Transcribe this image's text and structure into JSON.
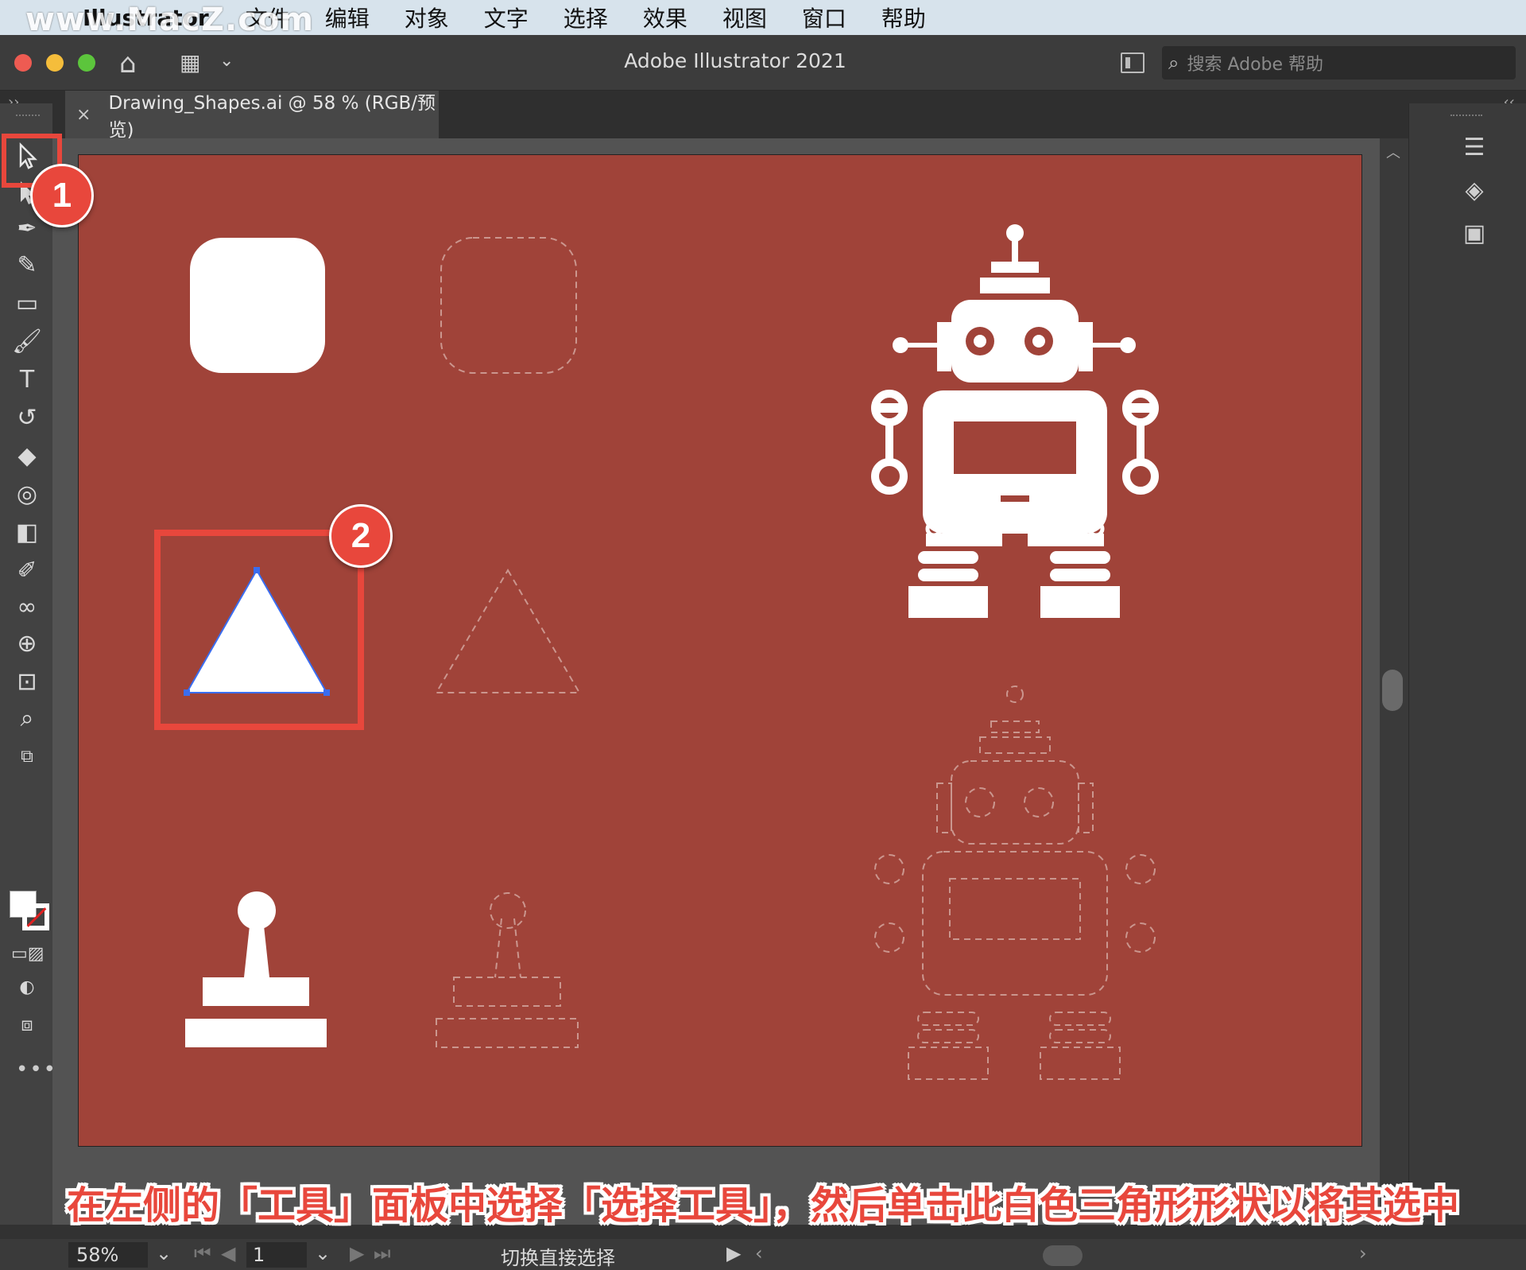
{
  "menubar": {
    "watermark": "www.MacZ.com",
    "app_name": "Illustrator",
    "items": [
      "文件",
      "编辑",
      "对象",
      "文字",
      "选择",
      "效果",
      "视图",
      "窗口",
      "帮助"
    ]
  },
  "titlebar": {
    "title": "Adobe Illustrator 2021",
    "search_placeholder": "搜索 Adobe 帮助"
  },
  "document_tab": {
    "close": "×",
    "label": "Drawing_Shapes.ai @ 58 % (RGB/预览)"
  },
  "callouts": {
    "step1": "1",
    "step2": "2"
  },
  "caption": "在左侧的「工具」面板中选择「选择工具」，然后单击此白色三角形形状以将其选中",
  "statusbar": {
    "zoom": "58%",
    "page": "1",
    "status_text": "切换直接选择"
  },
  "colors": {
    "artboard": "#a04339",
    "accent_red": "#e8473c",
    "selection_blue": "#3a6df0"
  },
  "icons": {
    "toolbar": [
      "selection-tool-icon",
      "direct-selection-tool-icon",
      "pen-tool-icon",
      "curvature-tool-icon",
      "rectangle-tool-icon",
      "paintbrush-tool-icon",
      "type-tool-icon",
      "rotate-tool-icon",
      "eraser-tool-icon",
      "lasso-tool-icon",
      "gradient-tool-icon",
      "eyedropper-tool-icon",
      "blend-tool-icon",
      "shape-builder-tool-icon",
      "artboard-tool-icon",
      "zoom-tool-icon"
    ],
    "right_panel": [
      "properties-icon",
      "layers-icon",
      "libraries-icon"
    ]
  }
}
